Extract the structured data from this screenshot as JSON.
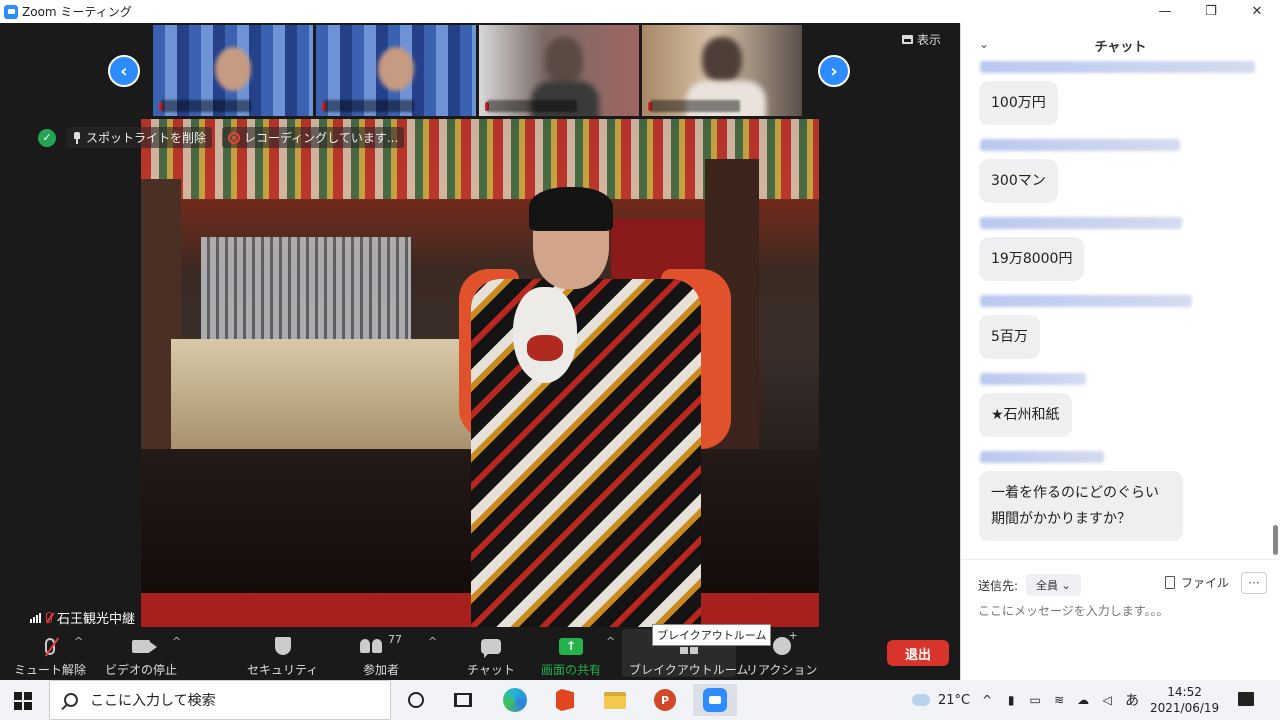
{
  "window": {
    "title": "Zoom ミーティング",
    "controls": {
      "minimize": "—",
      "restore": "❐",
      "close": "✕"
    }
  },
  "video": {
    "view_label": "表示",
    "nav_prev": "‹",
    "nav_next": "›",
    "spotlight_label": "スポットライトを削除",
    "recording_label": "レコーディングしています...",
    "speaker_name": "石王観光中継"
  },
  "toolbar": {
    "mute": "ミュート解除",
    "video": "ビデオの停止",
    "security": "セキュリティ",
    "participants": "参加者",
    "participant_count": "77",
    "chat": "チャット",
    "share": "画面の共有",
    "breakout": "ブレイクアウトルーム",
    "reactions": "リアクション",
    "caret": "^",
    "leave": "退出",
    "tooltip": "ブレイクアウトルーム"
  },
  "chat": {
    "title": "チャット",
    "messages": [
      {
        "text": "100万円"
      },
      {
        "text": "300マン"
      },
      {
        "text": "19万8000円"
      },
      {
        "text": "5百万"
      },
      {
        "text": "★石州和紙"
      },
      {
        "text": "一着を作るのにどのぐらい期間がかかりますか？"
      }
    ],
    "to_label": "送信先:",
    "to_value": "全員",
    "file_label": "ファイル",
    "more_label": "···",
    "input_placeholder": "ここにメッセージを入力します。。。"
  },
  "taskbar": {
    "search_placeholder": "ここに入力して検索",
    "temperature": "21°C",
    "ime": "あ",
    "time": "14:52",
    "date": "2021/06/19",
    "ppt_letter": "P"
  }
}
